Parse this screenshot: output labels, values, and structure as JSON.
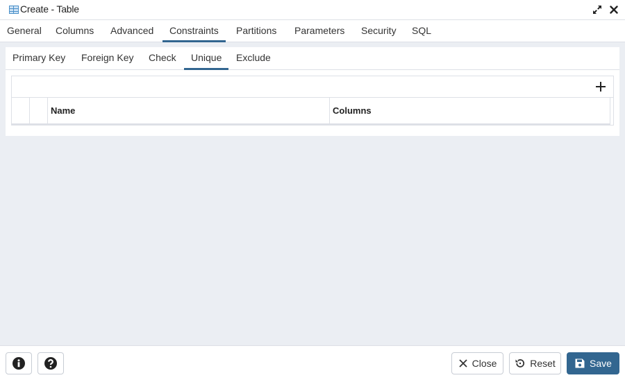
{
  "window": {
    "title": "Create - Table",
    "icon": "table-icon",
    "controls": [
      "expand-icon",
      "close-icon"
    ]
  },
  "tabs": [
    {
      "label": "General",
      "active": false
    },
    {
      "label": "Columns",
      "active": false
    },
    {
      "label": "Advanced",
      "active": false
    },
    {
      "label": "Constraints",
      "active": true
    },
    {
      "label": "Partitions",
      "active": false
    },
    {
      "label": "Parameters",
      "active": false
    },
    {
      "label": "Security",
      "active": false
    },
    {
      "label": "SQL",
      "active": false
    }
  ],
  "subtabs": [
    {
      "label": "Primary Key",
      "active": false
    },
    {
      "label": "Foreign Key",
      "active": false
    },
    {
      "label": "Check",
      "active": false
    },
    {
      "label": "Unique",
      "active": true
    },
    {
      "label": "Exclude",
      "active": false
    }
  ],
  "grid": {
    "add_icon": "plus-icon",
    "columns": [
      "Name",
      "Columns"
    ],
    "rows": []
  },
  "footer": {
    "info_icon": "info-icon",
    "help_icon": "help-icon",
    "close_label": "Close",
    "reset_label": "Reset",
    "save_label": "Save"
  },
  "colors": {
    "accent": "#326690",
    "background": "#ebeef3",
    "border": "#dde0e6"
  }
}
